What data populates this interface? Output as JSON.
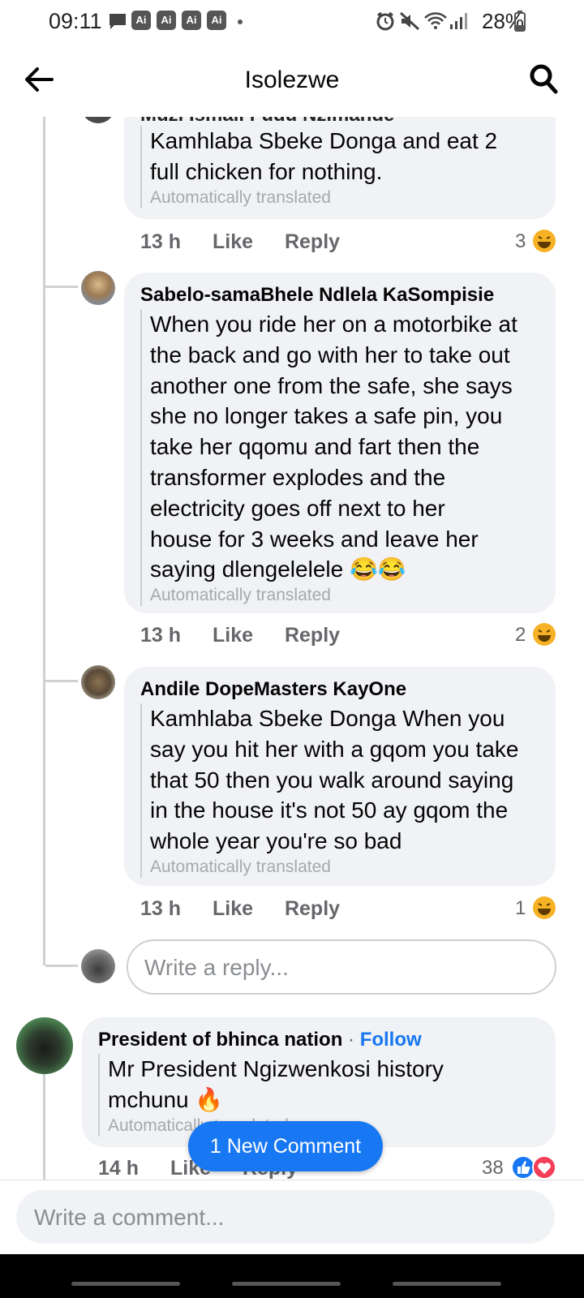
{
  "status_bar": {
    "time": "09:11",
    "ai_badges": [
      "Ai",
      "Ai",
      "Ai",
      "Ai"
    ],
    "battery": "28%"
  },
  "header": {
    "title": "Isolezwe"
  },
  "comments": [
    {
      "author": "Muzi Ismail Fudu Nzimande",
      "text_lines": [
        "Kamhlaba Sbeke Donga and eat 2",
        "full chicken for nothing."
      ],
      "auto_translated": "Automatically translated",
      "time": "13 h",
      "like": "Like",
      "reply": "Reply",
      "reaction_count": "3"
    },
    {
      "author": "Sabelo-samaBhele Ndlela KaSompisie",
      "text_lines": [
        "When you ride her on a motorbike at",
        "the back and go with her to take out",
        "another one from the safe, she says",
        "she no longer takes a safe pin, you",
        "take her qqomu and fart then the",
        "transformer explodes and the",
        "electricity goes off next to her",
        "house for 3 weeks and leave her",
        "saying dlengelelele 😂😂"
      ],
      "auto_translated": "Automatically translated",
      "time": "13 h",
      "like": "Like",
      "reply": "Reply",
      "reaction_count": "2"
    },
    {
      "author": "Andile DopeMasters KayOne",
      "text_lines": [
        "Kamhlaba Sbeke Donga When you",
        "say you hit her with a gqom you take",
        "that 50 then you walk around saying",
        "in the house it's not 50 ay gqom the",
        "whole year you're so bad"
      ],
      "auto_translated": "Automatically translated",
      "time": "13 h",
      "like": "Like",
      "reply": "Reply",
      "reaction_count": "1"
    }
  ],
  "reply_box": {
    "placeholder": "Write a reply..."
  },
  "top_comment": {
    "author": "President of bhinca nation",
    "separator": " · ",
    "follow": "Follow",
    "text_lines": [
      "Mr President Ngizwenkosi history",
      "mchunu 🔥"
    ],
    "auto_translated": "Automatically translated",
    "time": "14 h",
    "like": "Like",
    "reply": "Reply",
    "reaction_count": "38"
  },
  "new_comment_pill": "1 New Comment",
  "comment_box": {
    "placeholder": "Write a comment..."
  },
  "icons": {
    "back": "arrow-left-icon",
    "search": "search-icon",
    "laugh": "laugh-emoji-icon",
    "like": "like-reaction-icon",
    "love": "love-reaction-icon"
  },
  "colors": {
    "accent": "#1877f2",
    "bubble": "#f0f2f5",
    "secondary_text": "#65676b"
  }
}
